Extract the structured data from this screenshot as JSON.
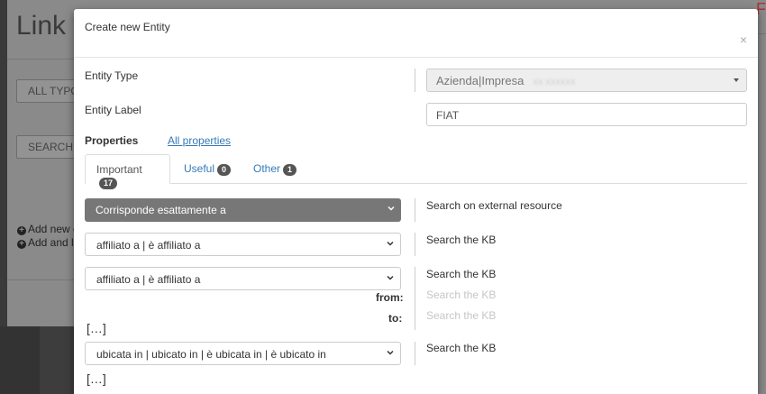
{
  "background": {
    "title": "Link t",
    "btn1": "ALL TYPO",
    "btn2": "SEARCH I",
    "add1": "Add new e",
    "add2": "Add and li"
  },
  "modal": {
    "title": "Create new Entity",
    "close_glyph": "×",
    "entity_type_label": "Entity Type",
    "entity_type_value": "Azienda|Impresa",
    "entity_label_label": "Entity Label",
    "entity_label_value": "FIAT",
    "properties_label": "Properties",
    "all_properties_link": "All properties",
    "tabs": [
      {
        "label": "Important",
        "count": "17"
      },
      {
        "label": "Useful",
        "count": "0"
      },
      {
        "label": "Other",
        "count": "1"
      }
    ],
    "rows": {
      "match_select": "Corrisponde esattamente a",
      "search_external": "Search on external resource",
      "affiliato_1": "affiliato a | è affiliato a",
      "search_kb_1": "Search the KB",
      "affiliato_2": "affiliato a | è affiliato a",
      "search_kb_2": "Search the KB",
      "from_label": "from:",
      "search_kb_from": "Search the KB",
      "to_label": "to:",
      "search_kb_to": "Search the KB",
      "ellipsis_1": "[…]",
      "ubicata": "ubicata in | ubicato in | è ubicata in | è ubicato in",
      "search_kb_3": "Search the KB",
      "ellipsis_2": "[…]"
    }
  },
  "icons": {
    "close": "close-icon",
    "chevron": "chevron-down-icon",
    "caret": "caret-down-icon",
    "plus": "plus-circle-icon"
  }
}
